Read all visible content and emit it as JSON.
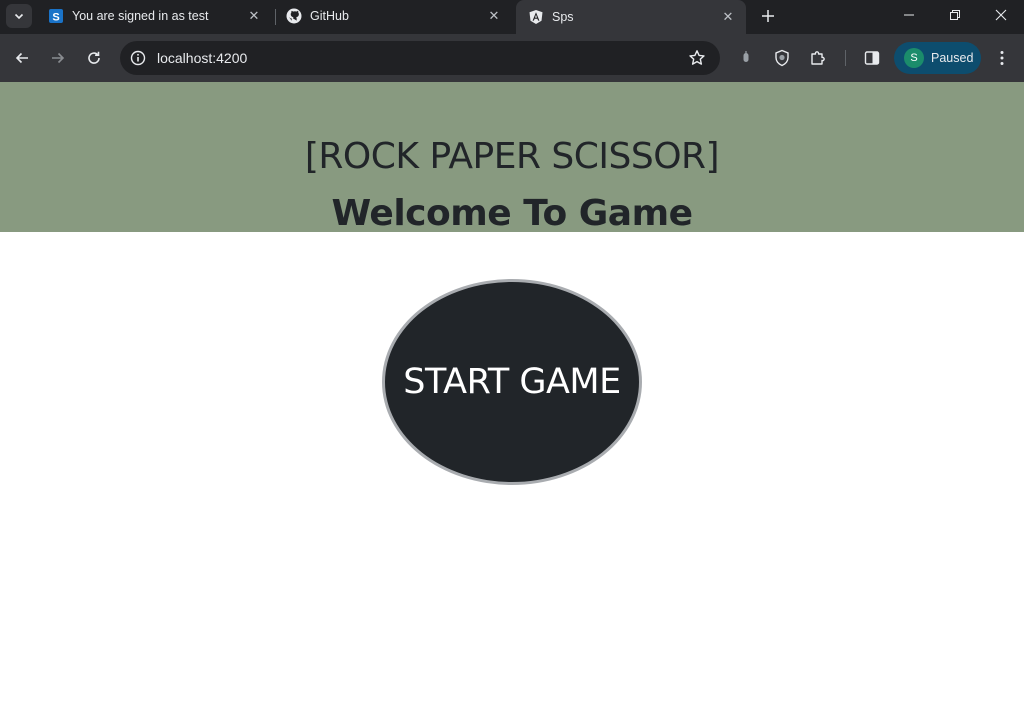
{
  "browser": {
    "tabs": [
      {
        "title": "You are signed in as test",
        "favicon": "s-logo-icon",
        "active": false
      },
      {
        "title": "GitHub",
        "favicon": "github-icon",
        "active": false
      },
      {
        "title": "Sps",
        "favicon": "angular-icon",
        "active": true
      }
    ],
    "address": "localhost:4200",
    "profile": {
      "initial": "S",
      "status": "Paused"
    }
  },
  "page": {
    "title": "[ROCK PAPER SCISSOR]",
    "subtitle": "Welcome To Game",
    "start_label": "START GAME"
  },
  "colors": {
    "hero_bg": "#889a80",
    "button_bg": "#212529",
    "text_dark": "#212529"
  }
}
